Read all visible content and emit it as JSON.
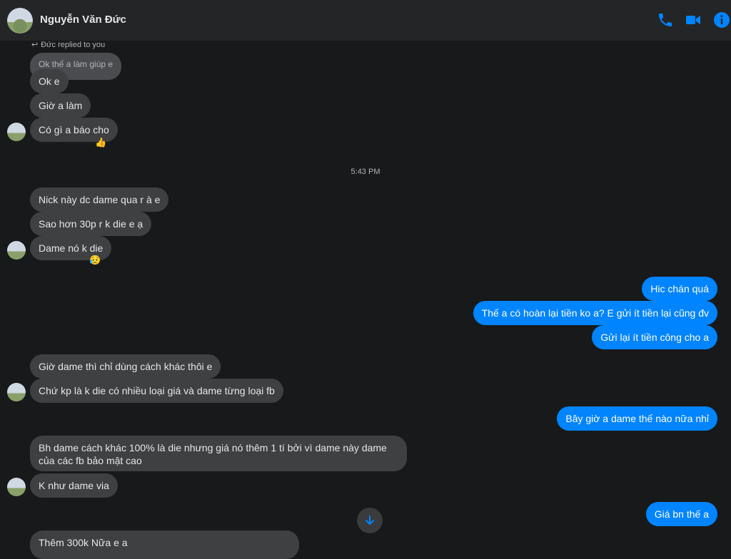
{
  "header": {
    "contact_name": "Nguyễn Văn Đức"
  },
  "colors": {
    "accent": "#0084ff",
    "incoming_bubble": "#3e4042",
    "background": "#18191a"
  },
  "icons": {
    "call": "phone-icon",
    "video": "video-camera-icon",
    "info": "info-icon",
    "scroll": "arrow-down-icon"
  },
  "reply_note": "Đức replied to you",
  "messages": {
    "quoted": "Ok thế a làm giúp e",
    "m1": "Ok e",
    "m2": "Giờ a làm",
    "m3": "Có gì a báo cho",
    "timestamp": "5:43 PM",
    "m4": "Nick này dc dame qua r à e",
    "m5": "Sao hơn 30p r k die e ạ",
    "m6": "Dame nó k die",
    "m7": "Hic chán quá",
    "m8": "Thế a có hoàn lại tiền ko a? E gửi ít tiền lại cũng đv",
    "m9": "Gửi lại ít tiền công cho a",
    "m10": "Giờ dame thì chỉ dùng cách khác thôi e",
    "m11": "Chứ kp là k die có nhiều loại giá và dame từng loại fb",
    "m12": "Bây giờ a dame thế nào nữa nhỉ",
    "m13": "Bh dame cách khác 100% là die nhưng giá nó thêm 1 tí bởi vì dame này dame của các fb bảo mật cao",
    "m14": "K như dame via",
    "m15": "Giá bn thế a",
    "m16": "Thêm 300k Nữa e a"
  },
  "reactions": {
    "m3": "👍",
    "m6": "😥"
  }
}
